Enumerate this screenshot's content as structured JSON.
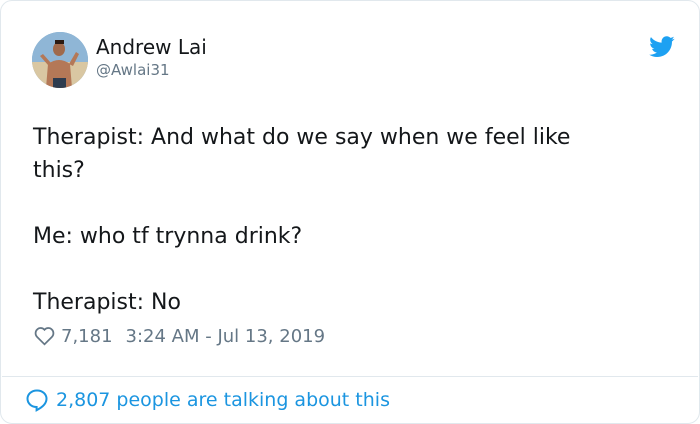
{
  "user": {
    "display_name": "Andrew Lai",
    "handle": "@Awlai31"
  },
  "tweet": {
    "lines": [
      "Therapist: And what do we say when we feel like",
      "this?",
      "",
      "Me: who tf trynna drink?",
      "",
      "Therapist: No"
    ]
  },
  "meta": {
    "likes": "7,181",
    "timestamp": "3:24 AM - Jul 13, 2019"
  },
  "footer": {
    "conversation": "2,807 people are talking about this"
  },
  "icons": {
    "brand": "twitter-bird-icon",
    "like": "heart-icon",
    "reply": "speech-bubble-icon"
  },
  "colors": {
    "brand": "#1da1f2",
    "link": "#1b95e0",
    "secondary_text": "#657786",
    "border": "#e1e8ed"
  }
}
